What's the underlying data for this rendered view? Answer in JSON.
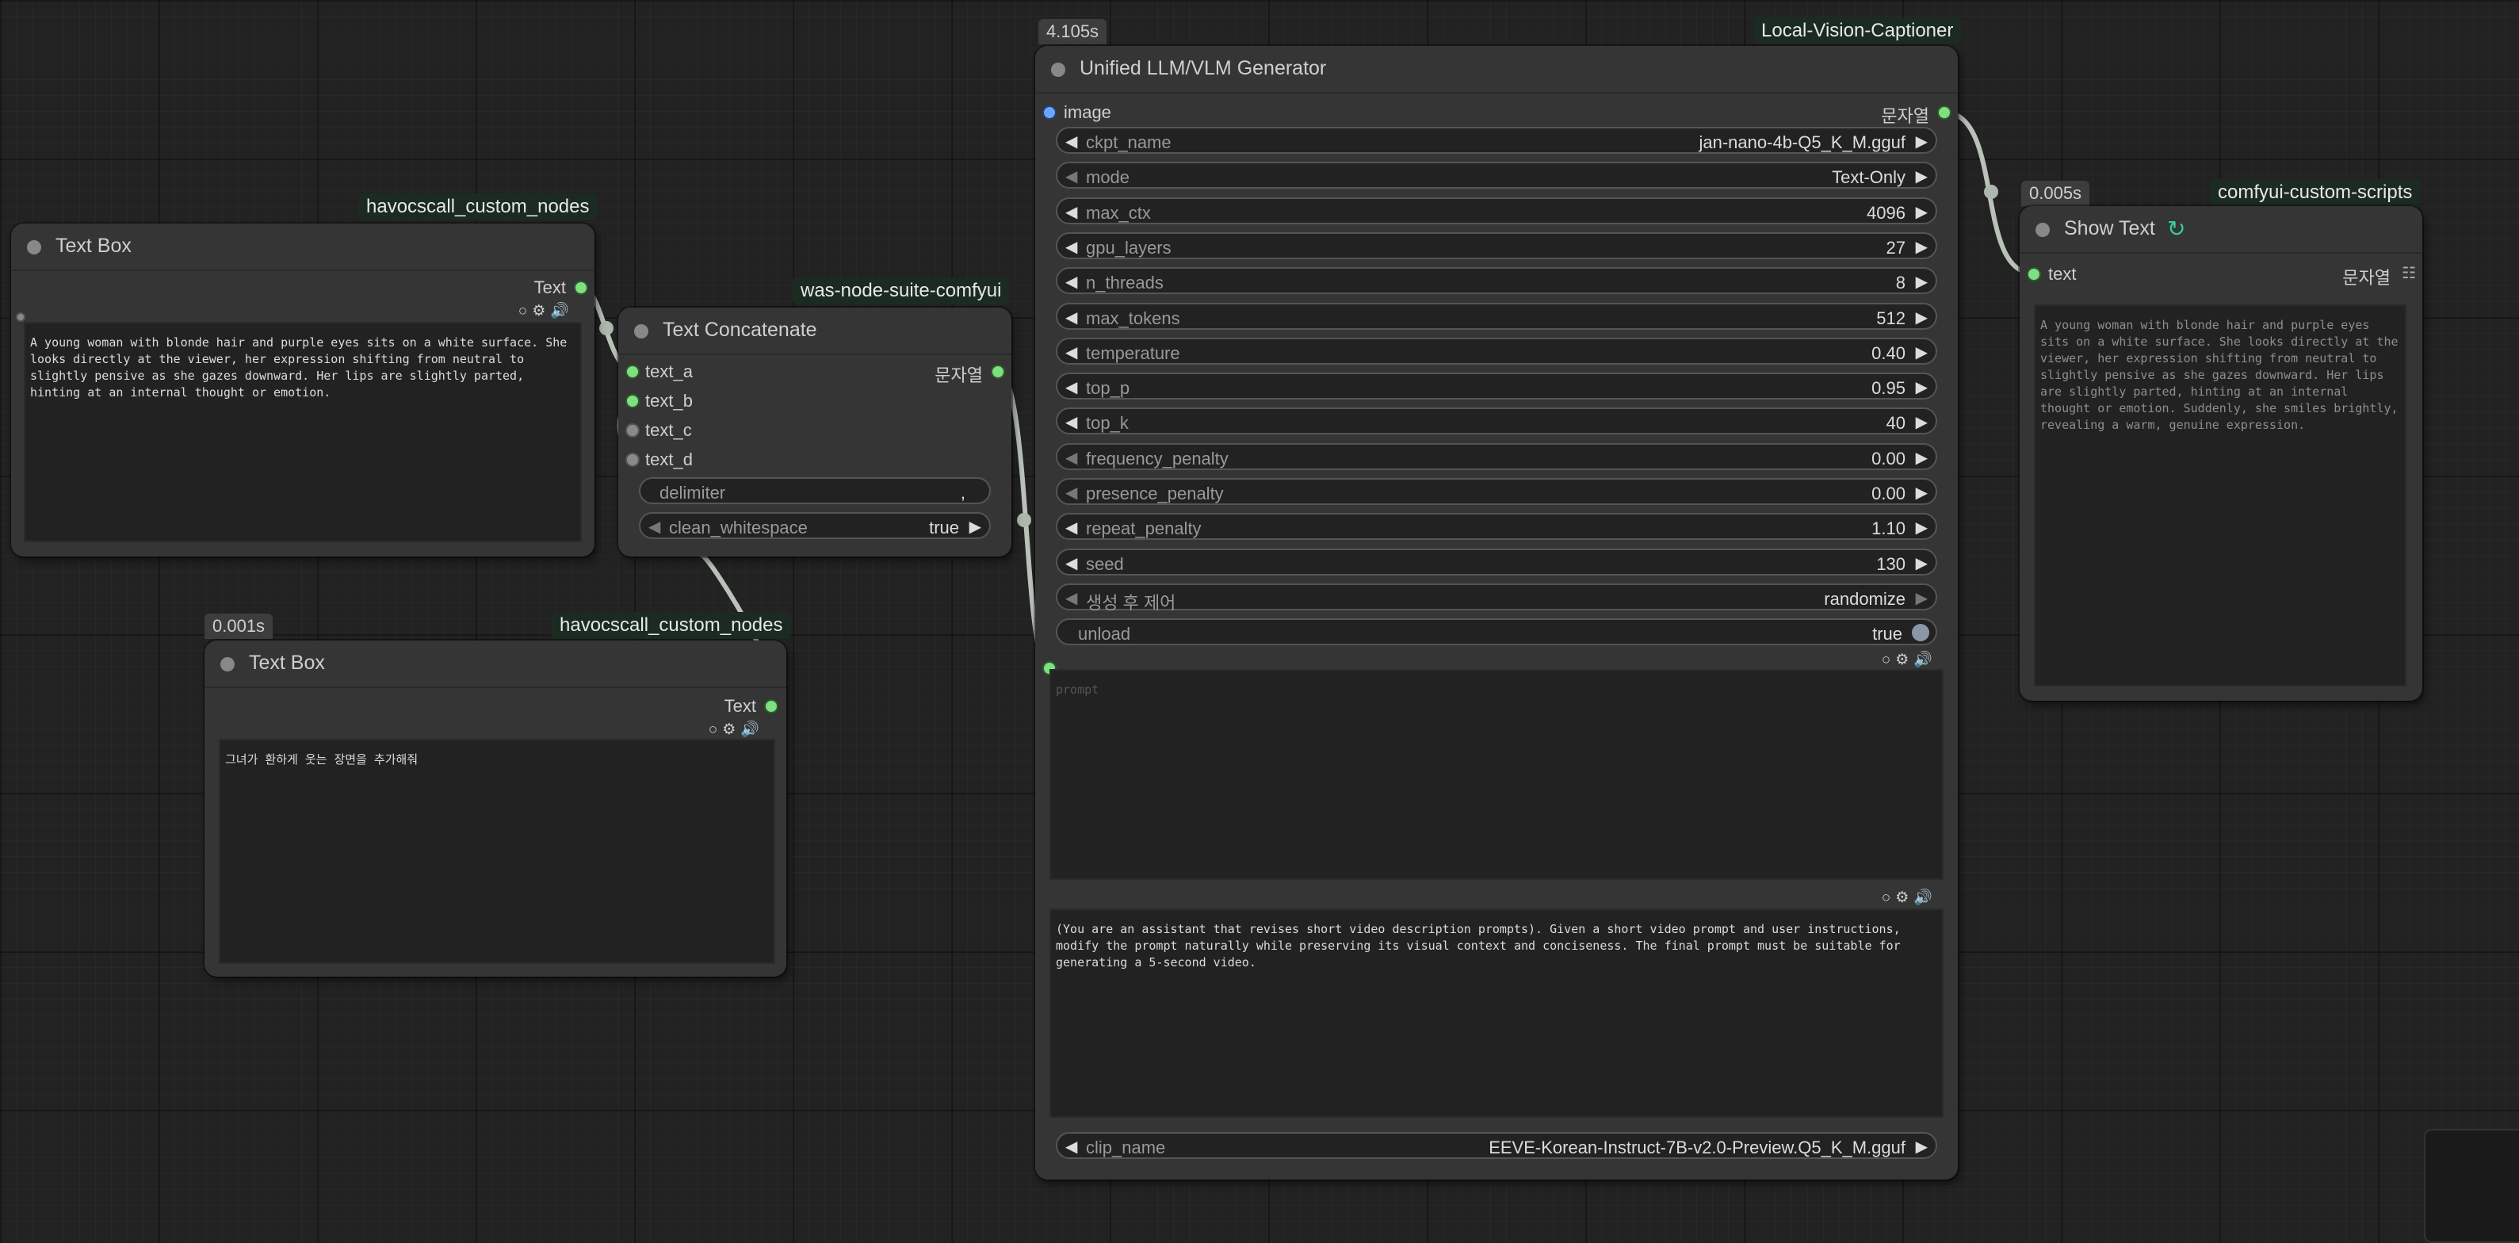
{
  "nodes": {
    "text_box_1": {
      "title": "Text Box",
      "badge": "havocscall_custom_nodes",
      "output_label": "Text",
      "text": "A young woman with blonde hair and purple eyes sits on a white surface. She looks directly at the viewer, her expression shifting from neutral to slightly pensive as she gazes downward. Her lips are slightly parted, hinting at an internal thought or emotion."
    },
    "text_box_2": {
      "title": "Text Box",
      "exec_time": "0.001s",
      "badge": "havocscall_custom_nodes",
      "output_label": "Text",
      "text": "그녀가 환하게 웃는 장면을 추가해줘"
    },
    "text_concat": {
      "title": "Text Concatenate",
      "badge": "was-node-suite-comfyui",
      "inputs": [
        "text_a",
        "text_b",
        "text_c",
        "text_d"
      ],
      "output_label": "문자열",
      "delimiter_label": "delimiter",
      "delimiter_value": ",",
      "clean_label": "clean_whitespace",
      "clean_value": "true"
    },
    "generator": {
      "title": "Unified LLM/VLM Generator",
      "exec_time": "4.105s",
      "badge": "Local-Vision-Captioner",
      "input_label": "image",
      "output_label": "문자열",
      "widgets": [
        {
          "name": "ckpt_name",
          "value": "jan-nano-4b-Q5_K_M.gguf"
        },
        {
          "name": "mode",
          "value": "Text-Only"
        },
        {
          "name": "max_ctx",
          "value": "4096"
        },
        {
          "name": "gpu_layers",
          "value": "27"
        },
        {
          "name": "n_threads",
          "value": "8"
        },
        {
          "name": "max_tokens",
          "value": "512"
        },
        {
          "name": "temperature",
          "value": "0.40"
        },
        {
          "name": "top_p",
          "value": "0.95"
        },
        {
          "name": "top_k",
          "value": "40"
        },
        {
          "name": "frequency_penalty",
          "value": "0.00"
        },
        {
          "name": "presence_penalty",
          "value": "0.00"
        },
        {
          "name": "repeat_penalty",
          "value": "1.10"
        },
        {
          "name": "seed",
          "value": "130"
        },
        {
          "name": "생성 후 제어",
          "value": "randomize"
        }
      ],
      "unload_label": "unload",
      "unload_value": "true",
      "prompt_placeholder": "prompt",
      "system_text": "(You are an assistant that revises short video description prompts). Given a short video prompt and user instructions, modify the prompt naturally while preserving its visual context and conciseness. The final prompt must be suitable for generating a 5-second video.",
      "clip_label": "clip_name",
      "clip_value": "EEVE-Korean-Instruct-7B-v2.0-Preview.Q5_K_M.gguf"
    },
    "show_text": {
      "title": "Show Text",
      "exec_time": "0.005s",
      "badge": "comfyui-custom-scripts",
      "input_label": "text",
      "output_label": "문자열",
      "text": "A young woman with blonde hair and purple eyes sits on a white surface. She looks directly at the viewer, her expression shifting from neutral to slightly pensive as she gazes downward. Her lips are slightly parted, hinting at an internal thought or emotion. Suddenly, she smiles brightly, revealing a warm, genuine expression."
    }
  },
  "icons": {
    "widget_tools": [
      "circle-icon",
      "gear-icon",
      "speaker-icon"
    ],
    "show_text_title_icon": "refresh-link-icon",
    "output_grid_icon": "grid-icon"
  },
  "colors": {
    "link": "#a9b6a9",
    "slot_green": "#7ee07e",
    "slot_blue": "#6aa6ff",
    "badge_bg": "#1b2b22"
  }
}
